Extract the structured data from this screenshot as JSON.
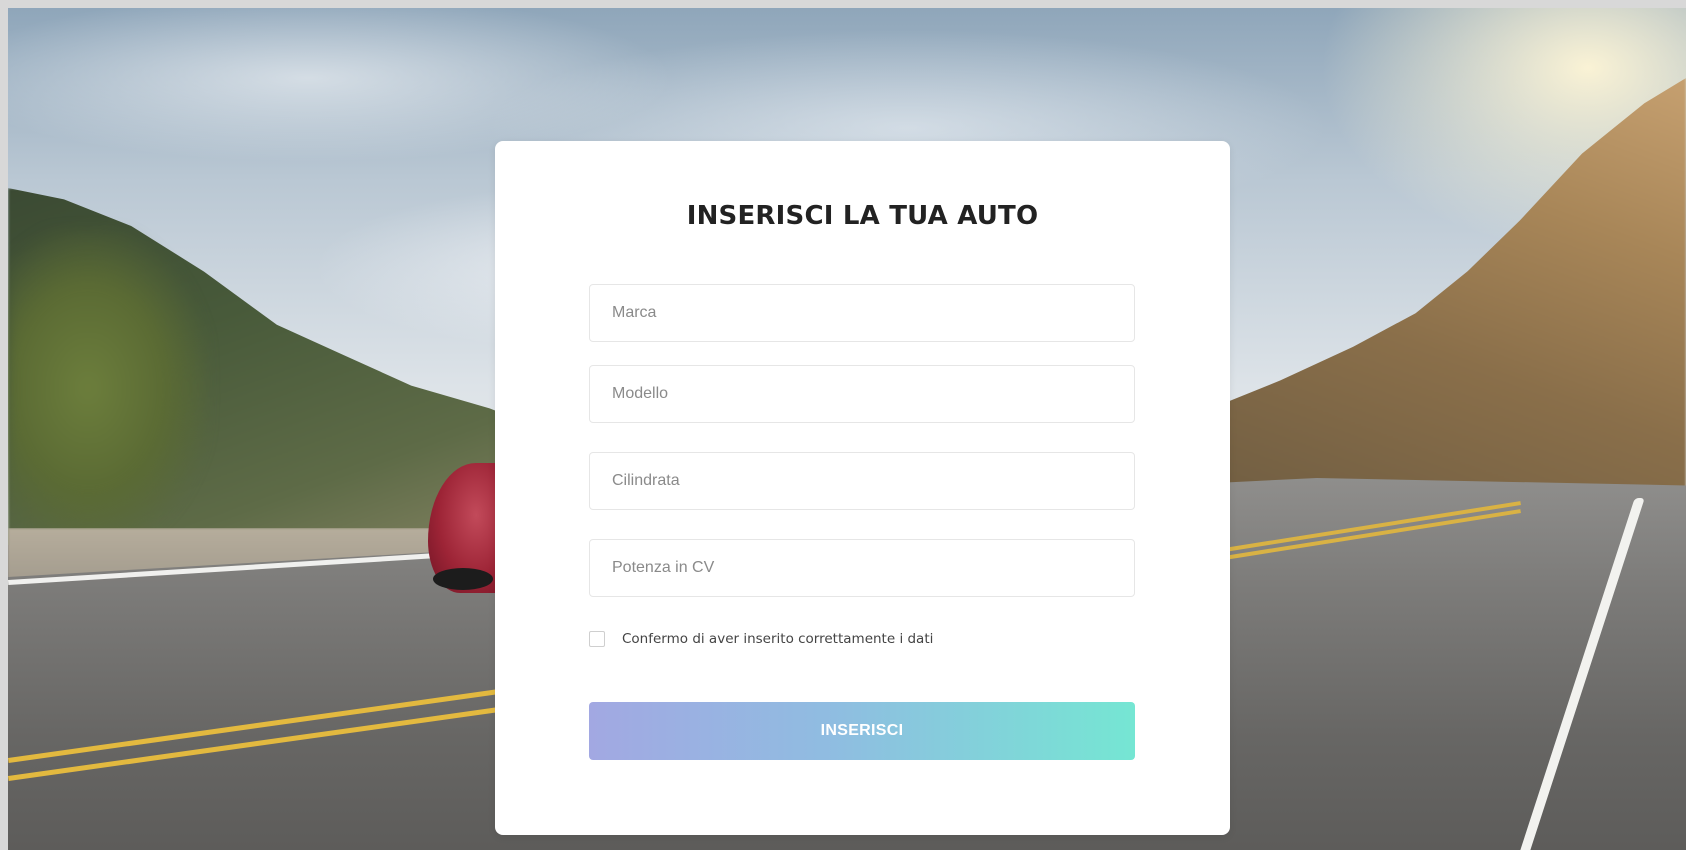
{
  "form": {
    "title": "INSERISCI LA TUA AUTO",
    "fields": [
      {
        "placeholder": "Marca",
        "value": ""
      },
      {
        "placeholder": "Modello",
        "value": ""
      },
      {
        "placeholder": "Cilindrata",
        "value": ""
      },
      {
        "placeholder": "Potenza in CV",
        "value": ""
      }
    ],
    "confirm_label": "Confermo di aver inserito correttamente i dati",
    "confirm_checked": false,
    "submit_label": "INSERISCI"
  },
  "colors": {
    "button_gradient_start": "#a2a8e2",
    "button_gradient_end": "#75e6d3",
    "card_background": "#ffffff",
    "title_color": "#222222"
  }
}
